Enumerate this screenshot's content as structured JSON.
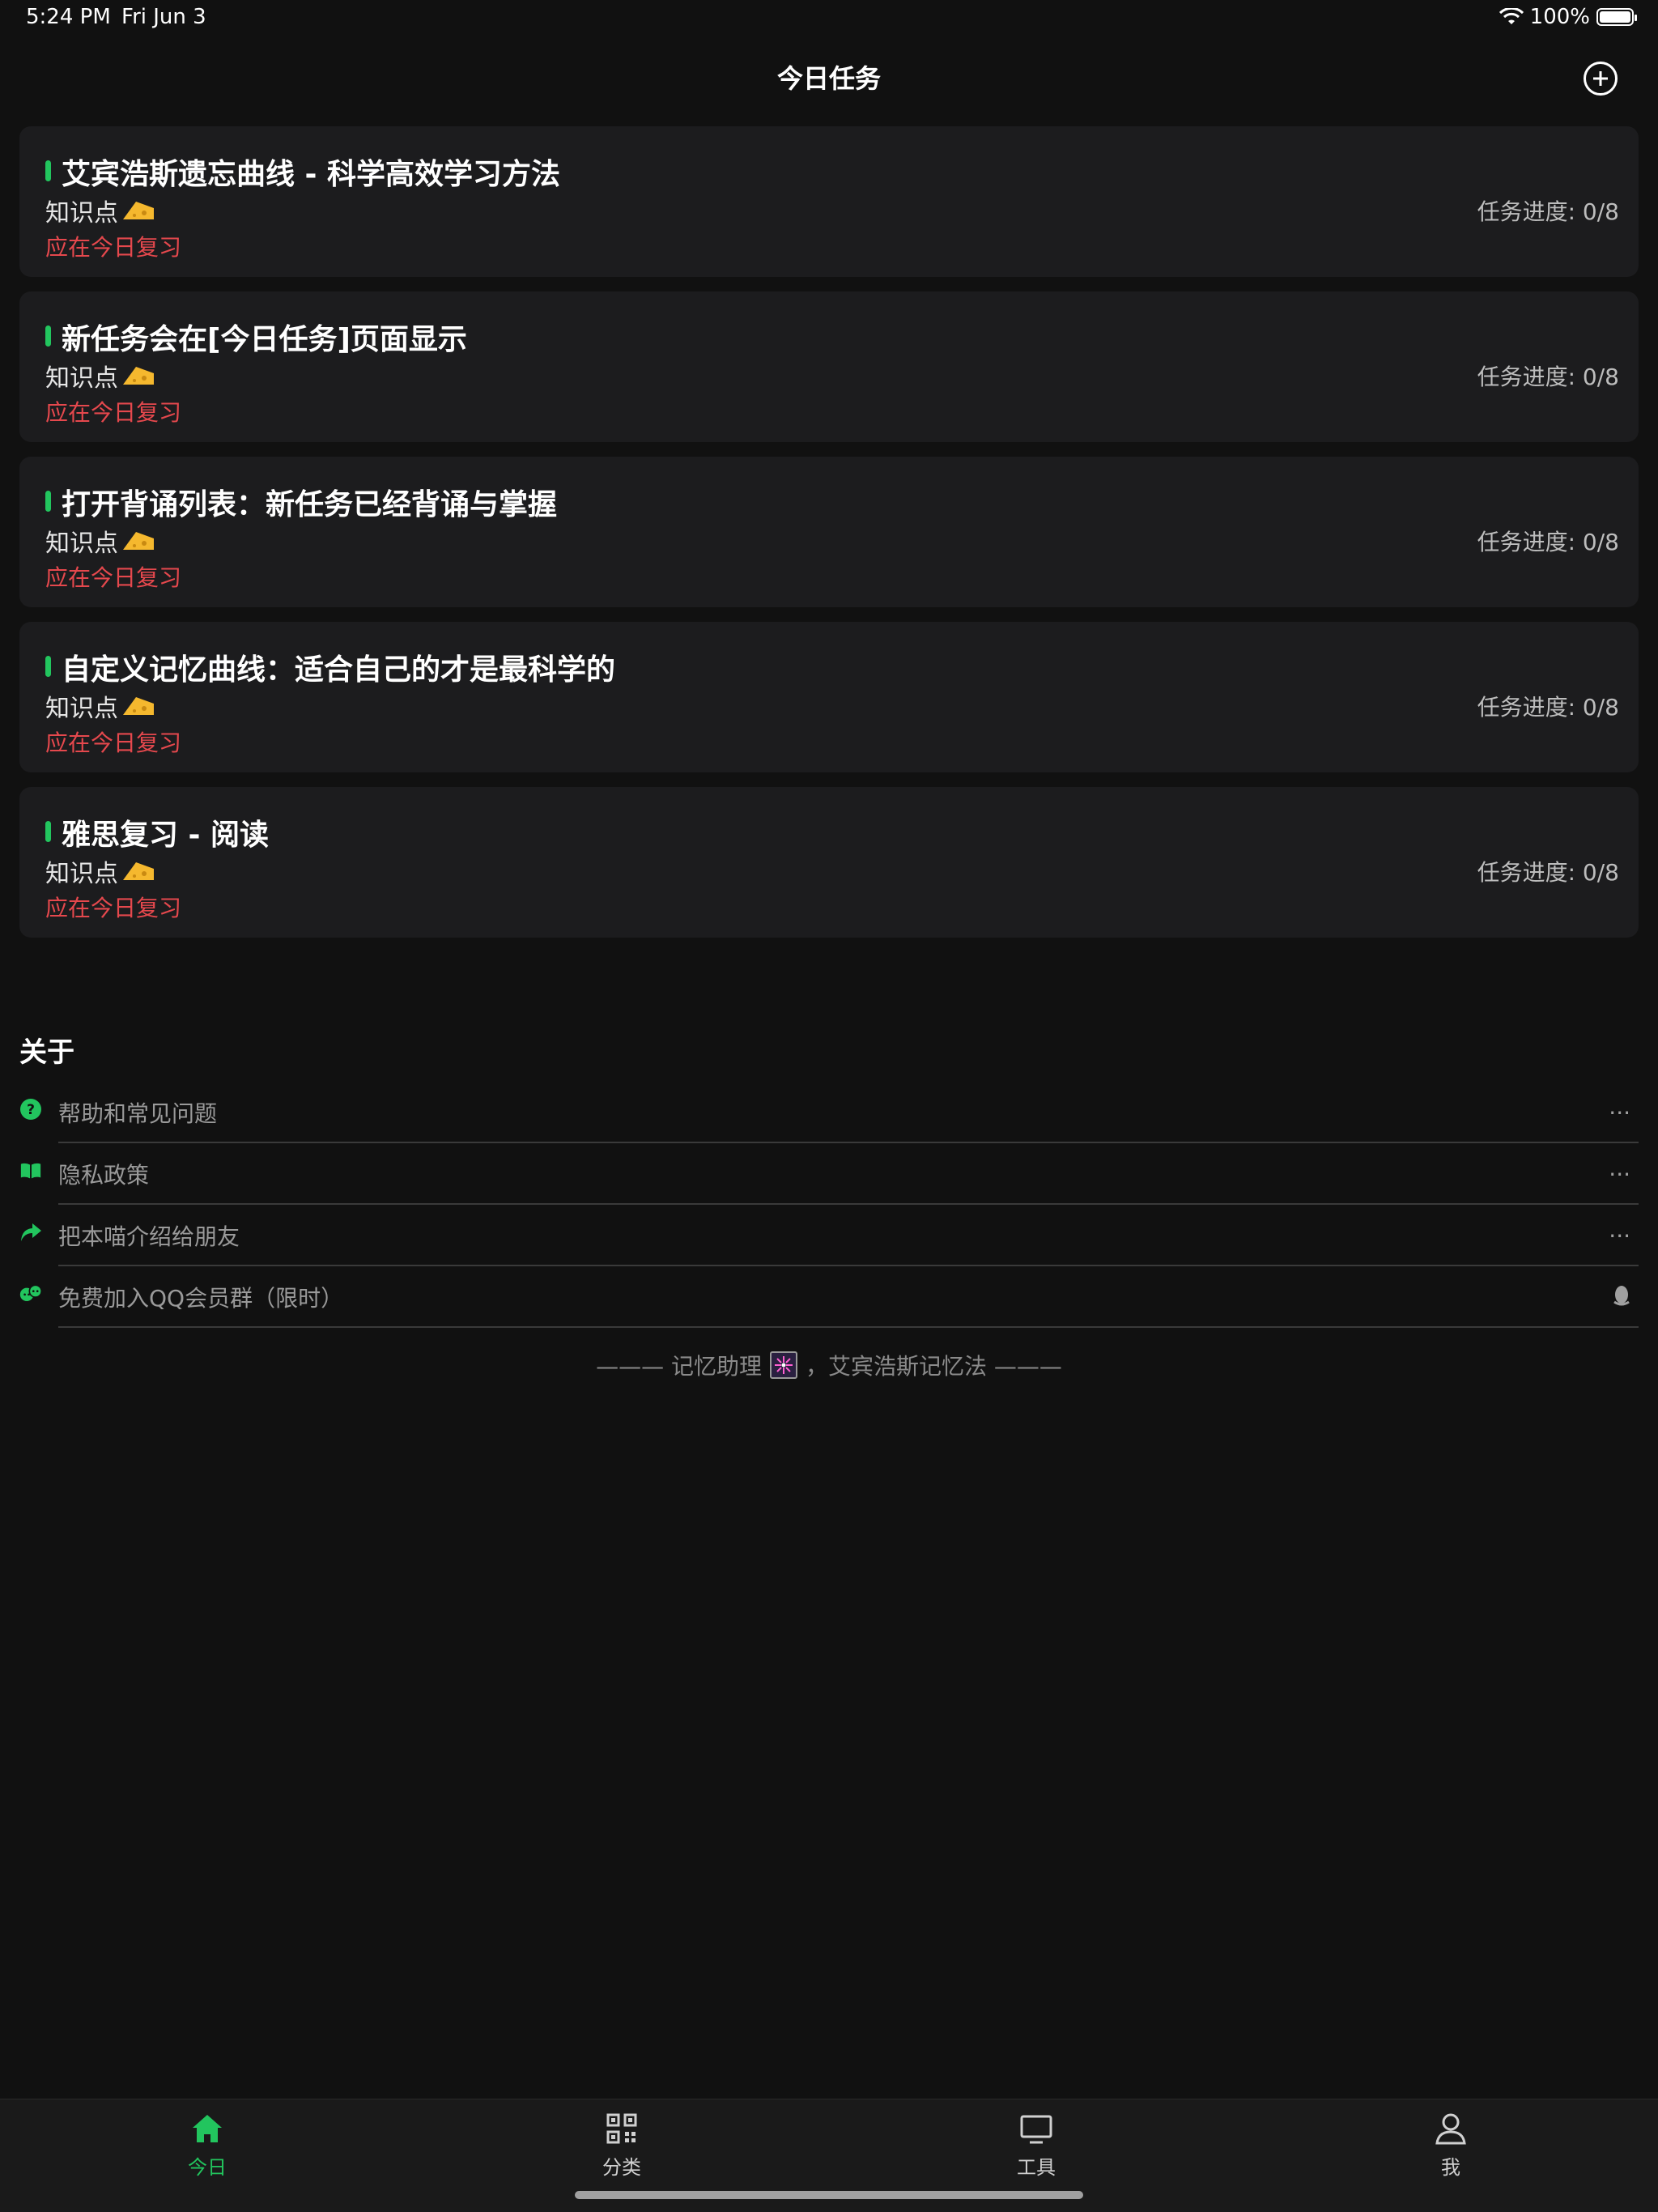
{
  "status_bar": {
    "time": "5:24 PM",
    "date": "Fri Jun 3",
    "battery": "100%",
    "battery_level": 1.0
  },
  "nav": {
    "title": "今日任务",
    "add_icon": "plus-circle-icon"
  },
  "tasks": [
    {
      "title": "艾宾浩斯遗忘曲线 - 科学高效学习方法",
      "subtitle": "知识点",
      "warning": "应在今日复习",
      "progress": "任务进度: 0/8"
    },
    {
      "title": "新任务会在[今日任务]页面显示",
      "subtitle": "知识点",
      "warning": "应在今日复习",
      "progress": "任务进度: 0/8"
    },
    {
      "title": "打开背诵列表：新任务已经背诵与掌握",
      "subtitle": "知识点",
      "warning": "应在今日复习",
      "progress": "任务进度: 0/8"
    },
    {
      "title": "自定义记忆曲线：适合自己的才是最科学的",
      "subtitle": "知识点",
      "warning": "应在今日复习",
      "progress": "任务进度: 0/8"
    },
    {
      "title": "雅思复习 - 阅读",
      "subtitle": "知识点",
      "warning": "应在今日复习",
      "progress": "任务进度: 0/8"
    }
  ],
  "about": {
    "title": "关于",
    "items": [
      {
        "label": "帮助和常见问题",
        "icon": "question-circle-icon",
        "trail": "···"
      },
      {
        "label": "隐私政策",
        "icon": "book-icon",
        "trail": "···"
      },
      {
        "label": "把本喵介绍给朋友",
        "icon": "share-arrow-icon",
        "trail": "···"
      },
      {
        "label": "免费加入QQ会员群（限时）",
        "icon": "group-chat-icon",
        "trail_icon": "qq-penguin-icon"
      }
    ]
  },
  "footer": {
    "left": "——— 记忆助理",
    "right": "，艾宾浩斯记忆法 ———"
  },
  "tab_bar": {
    "items": [
      {
        "label": "今日",
        "icon": "home-icon",
        "active": true
      },
      {
        "label": "分类",
        "icon": "qr-grid-icon",
        "active": false
      },
      {
        "label": "工具",
        "icon": "monitor-icon",
        "active": false
      },
      {
        "label": "我",
        "icon": "person-icon",
        "active": false
      }
    ]
  },
  "colors": {
    "accent": "#22c55e",
    "warning": "#e5484d",
    "background": "#111111",
    "card": "#1c1c1e"
  }
}
